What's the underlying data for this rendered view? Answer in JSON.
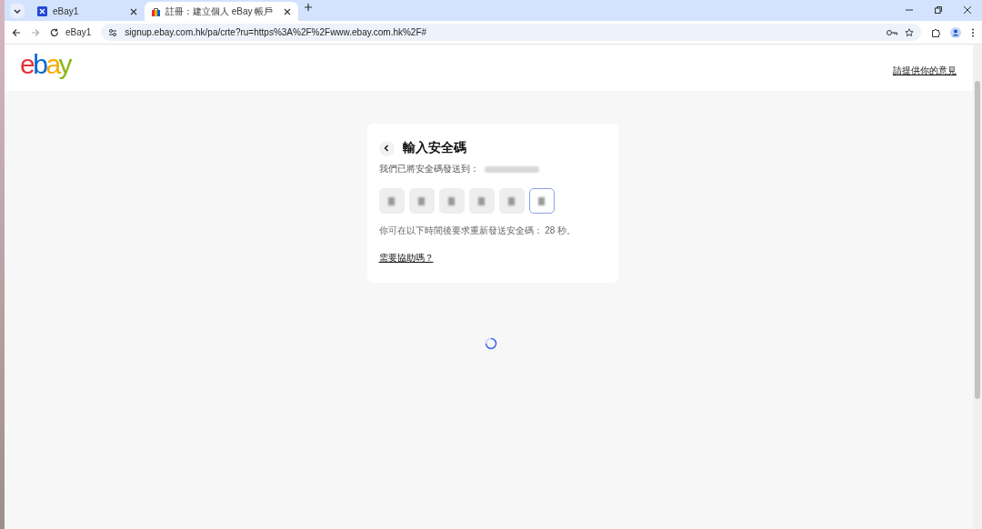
{
  "browser": {
    "tabs": [
      {
        "title": "eBay1",
        "selected": false
      },
      {
        "title": "註冊：建立個人 eBay 帳戶",
        "selected": true
      }
    ],
    "profile_chip": "eBay1",
    "url": "signup.ebay.com.hk/pa/crte?ru=https%3A%2F%2Fwww.ebay.com.hk%2F#"
  },
  "header": {
    "logo": [
      {
        "text": "e",
        "color": "#e53238"
      },
      {
        "text": "b",
        "color": "#0064d2"
      },
      {
        "text": "a",
        "color": "#f5af02"
      },
      {
        "text": "y",
        "color": "#86b817"
      }
    ],
    "feedback_link": "請提供你的意見"
  },
  "card": {
    "title": "輸入安全碼",
    "subtitle": "我們已將安全碼發送到：",
    "recipient_blurred": true,
    "code_boxes": [
      {
        "filled": true,
        "selected": false
      },
      {
        "filled": true,
        "selected": false
      },
      {
        "filled": true,
        "selected": false
      },
      {
        "filled": true,
        "selected": false
      },
      {
        "filled": true,
        "selected": false
      },
      {
        "filled": true,
        "selected": true
      }
    ],
    "resend_note": "你可在以下時間後要求重新發送安全碼： 28 秒。",
    "help_link": "需要協助嗎？"
  },
  "loading": true
}
